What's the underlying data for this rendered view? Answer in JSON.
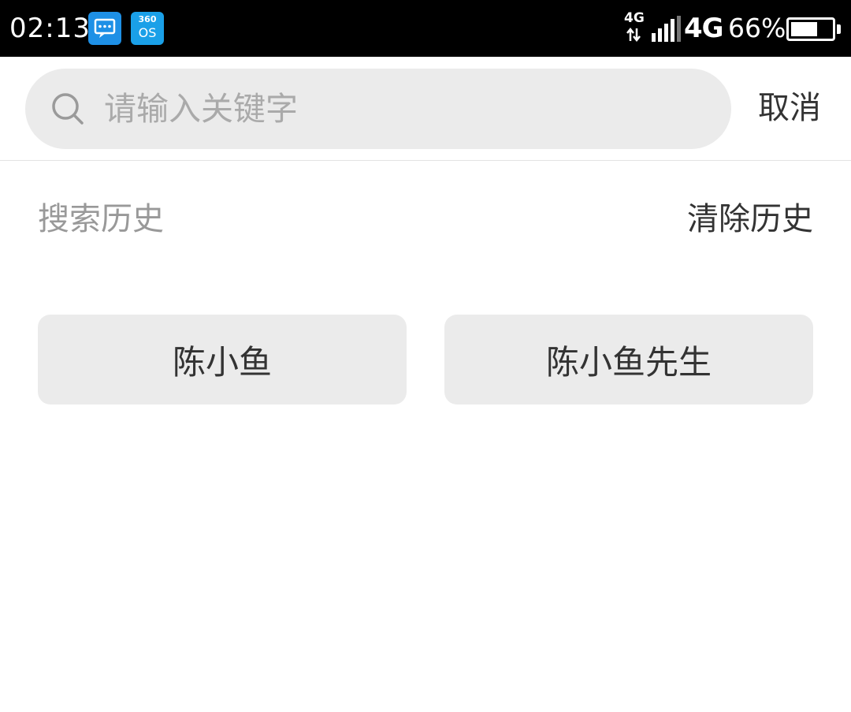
{
  "status_bar": {
    "time": "02:13",
    "os_badge_top": "360",
    "os_badge_bottom": "OS",
    "network_small": "4G",
    "network_big": "4G",
    "battery_percent": "66%",
    "battery_level": 0.66,
    "icons": [
      "message-icon",
      "360os-icon",
      "data-arrows-icon",
      "signal-bars-icon",
      "battery-icon"
    ]
  },
  "search": {
    "placeholder": "请输入关键字",
    "value": "",
    "cancel_label": "取消"
  },
  "history": {
    "title": "搜索历史",
    "clear_label": "清除历史",
    "items": [
      "陈小鱼",
      "陈小鱼先生"
    ]
  },
  "colors": {
    "status_bar_bg": "#000000",
    "search_box_bg": "#ebebeb",
    "chip_bg": "#ebebeb",
    "muted_text": "#999999",
    "primary_text": "#333333"
  }
}
